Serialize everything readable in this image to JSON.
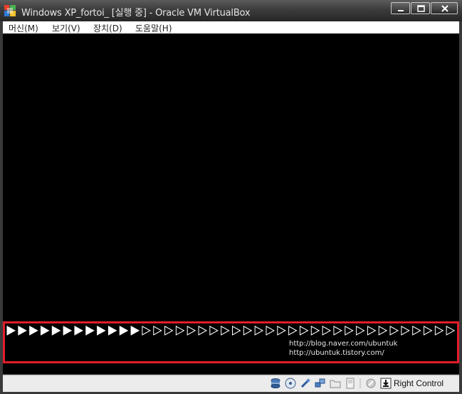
{
  "window": {
    "title": "Windows XP_fortoi_ [실행 중] - Oracle VM VirtualBox"
  },
  "menu": {
    "machine": "머신(M)",
    "view": "보기(V)",
    "devices": "장치(D)",
    "help": "도움말(H)"
  },
  "boot_screen": {
    "progress": {
      "total_arrows": 40,
      "filled_arrows": 12
    },
    "url_line1": "http://blog.naver.com/ubuntuk",
    "url_line2": "http://ubuntuk.tistory.com/",
    "highlight_color": "#e11d2a"
  },
  "statusbar": {
    "icons": [
      "hard-disk-icon",
      "optical-drive-icon",
      "usb-icon",
      "network-icon",
      "shared-folders-icon",
      "floppy-icon",
      "virtualization-icon",
      "host-key-arrow-icon"
    ],
    "host_key": "Right Control"
  }
}
